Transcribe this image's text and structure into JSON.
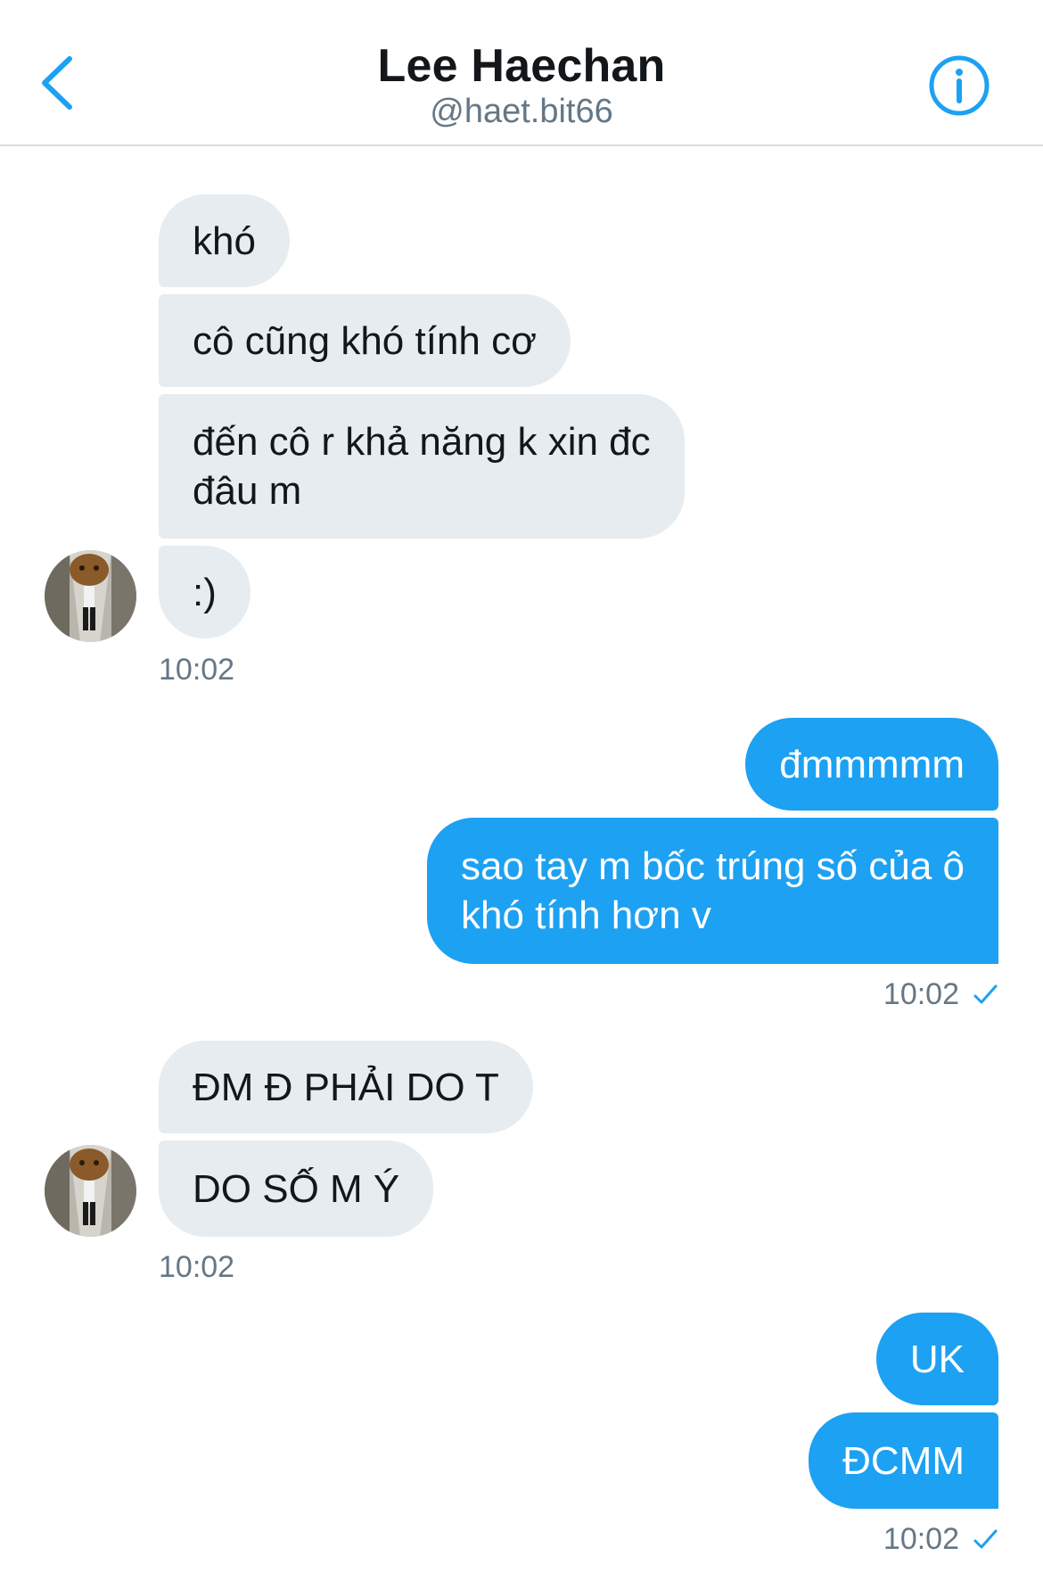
{
  "header": {
    "title": "Lee Haechan",
    "handle": "@haet.bit66",
    "back_icon": "chevron-left-icon",
    "info_icon": "info-circle-icon"
  },
  "colors": {
    "accent": "#1da1f2",
    "incoming_bubble": "#e6ecf0",
    "muted_text": "#657786",
    "divider": "#d9dde1"
  },
  "groups": [
    {
      "direction": "incoming",
      "messages": [
        "khó",
        "cô cũng khó tính cơ",
        "đến cô r khả năng k xin đc\nđâu m",
        ":)"
      ],
      "time": "10:02"
    },
    {
      "direction": "outgoing",
      "messages": [
        "đmmmmm",
        "sao tay m bốc trúng số của ô\nkhó tính hơn v"
      ],
      "time": "10:02",
      "status_icon": "check-icon"
    },
    {
      "direction": "incoming",
      "messages": [
        "ĐM Đ PHẢI DO T",
        "DO SỐ M Ý"
      ],
      "time": "10:02"
    },
    {
      "direction": "outgoing",
      "messages": [
        "UK",
        "ĐCMM"
      ],
      "time": "10:02",
      "status_icon": "check-icon"
    }
  ]
}
